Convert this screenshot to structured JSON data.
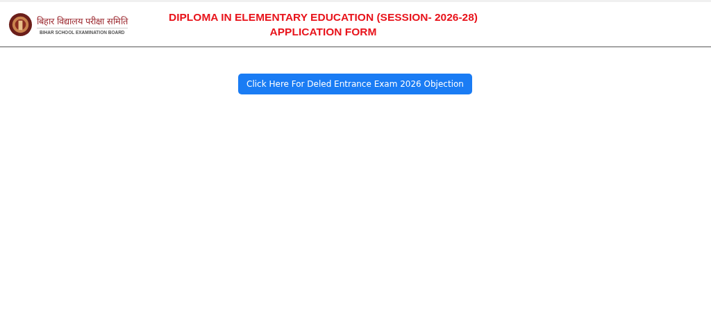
{
  "header": {
    "logo": {
      "title": "बिहार विद्यालय परीक्षा समिति",
      "subtitle": "BIHAR SCHOOL EXAMINATION BOARD"
    },
    "title_lines": [
      "DIPLOMA IN ELEMENTARY EDUCATION (SESSION- 2026-28)",
      "APPLICATION FORM"
    ]
  },
  "objection_button": {
    "label": "Click Here For Deled Entrance Exam 2026 Objection"
  }
}
